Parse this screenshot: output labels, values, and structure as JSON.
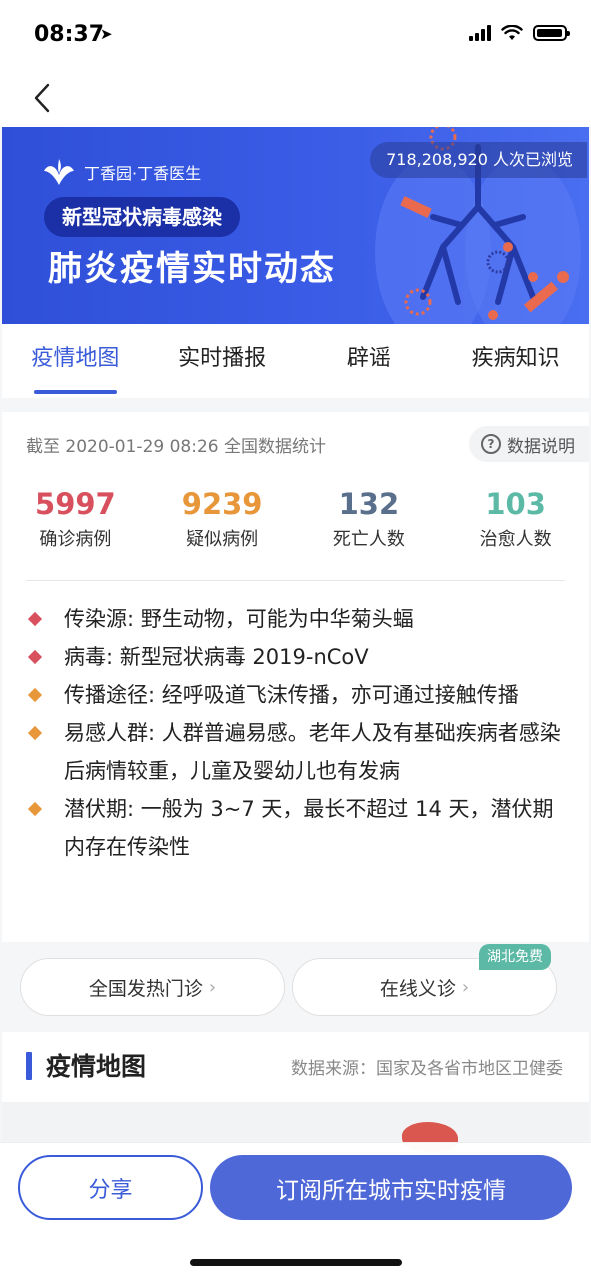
{
  "status_bar": {
    "time": "08:37",
    "location_icon": "location-arrow-icon"
  },
  "nav": {
    "back_icon": "chevron-left-icon"
  },
  "banner": {
    "brand": "丁香园·丁香医生",
    "views": "718,208,920 人次已浏览",
    "subtitle": "新型冠状病毒感染",
    "title": "肺炎疫情实时动态"
  },
  "tabs": [
    {
      "label": "疫情地图",
      "active": true
    },
    {
      "label": "实时播报",
      "active": false
    },
    {
      "label": "辟谣",
      "active": false
    },
    {
      "label": "疾病知识",
      "active": false
    }
  ],
  "stats": {
    "header": "截至 2020-01-29 08:26 全国数据统计",
    "note_label": "数据说明",
    "items": [
      {
        "value": "5997",
        "label": "确诊病例",
        "color": "#d8505e"
      },
      {
        "value": "9239",
        "label": "疑似病例",
        "color": "#e8963a"
      },
      {
        "value": "132",
        "label": "死亡人数",
        "color": "#5a6f8c"
      },
      {
        "value": "103",
        "label": "治愈人数",
        "color": "#5bb9a6"
      }
    ]
  },
  "info": [
    {
      "text": "传染源: 野生动物，可能为中华菊头蝠",
      "bullet": "red"
    },
    {
      "text": "病毒: 新型冠状病毒 2019-nCoV",
      "bullet": "red"
    },
    {
      "text": "传播途径: 经呼吸道飞沫传播，亦可通过接触传播",
      "bullet": "orange"
    },
    {
      "text": "易感人群: 人群普遍易感。老年人及有基础疾病者感染后病情较重，儿童及婴幼儿也有发病",
      "bullet": "orange"
    },
    {
      "text": "潜伏期: 一般为 3~7 天，最长不超过 14 天，潜伏期内存在传染性",
      "bullet": "orange"
    }
  ],
  "services": {
    "fever_clinic": "全国发热门诊",
    "online_consult": "在线义诊",
    "badge": "湖北免费"
  },
  "map_section": {
    "title": "疫情地图",
    "source": "数据来源：国家及各省市地区卫健委"
  },
  "bottom": {
    "share": "分享",
    "subscribe": "订阅所在城市实时疫情"
  },
  "colors": {
    "accent": "#3a5bd9",
    "banner": "#3a5ce6"
  }
}
